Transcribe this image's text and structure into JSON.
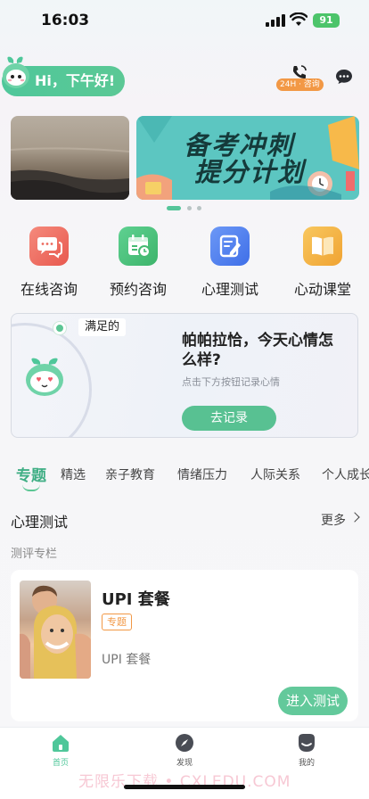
{
  "status_bar": {
    "time": "16:03",
    "battery": "91"
  },
  "header": {
    "greeting": "Hi，下午好!",
    "consult_badge": "24H · 咨询",
    "icons": {
      "phone": "phone-icon",
      "chat": "chat-bubble-icon",
      "mascot": "mascot-avatar"
    }
  },
  "banner": {
    "title_line1": "备考冲刺",
    "title_line2": "提分计划",
    "pages": 3,
    "active_page": 1
  },
  "quick_entries": [
    {
      "label": "在线咨询",
      "icon": "chat-bubbles-icon",
      "color": "#ef6d63"
    },
    {
      "label": "预约咨询",
      "icon": "calendar-clock-icon",
      "color": "#4cc27d"
    },
    {
      "label": "心理测试",
      "icon": "edit-note-icon",
      "color": "#4f7ef0"
    },
    {
      "label": "心动课堂",
      "icon": "book-icon",
      "color": "#f2b240"
    }
  ],
  "mood_card": {
    "mood_tag": "满足的",
    "title": "帕帕拉恰，今天心情怎么样?",
    "subtitle": "点击下方按钮记录心情",
    "button": "去记录"
  },
  "topic_tabs": [
    "专题",
    "精选",
    "亲子教育",
    "情绪压力",
    "人际关系",
    "个人成长"
  ],
  "active_tab": 0,
  "section": {
    "title": "心理测试",
    "more": "更多",
    "subtitle": "测评专栏"
  },
  "test_card": {
    "title": "UPI 套餐",
    "tag": "专题",
    "description": "UPI 套餐",
    "button": "进入测试"
  },
  "bottom_nav": [
    {
      "label": "首页",
      "icon": "home-icon",
      "active": true
    },
    {
      "label": "发现",
      "icon": "compass-icon",
      "active": false
    },
    {
      "label": "我的",
      "icon": "profile-icon",
      "active": false
    }
  ],
  "accent_color": "#5cc694",
  "watermark": "无限乐下载 • CXLEDU.COM"
}
